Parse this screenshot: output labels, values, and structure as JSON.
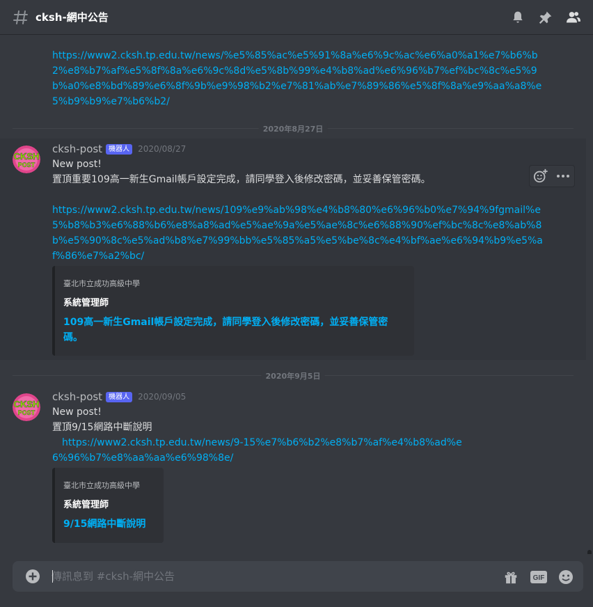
{
  "header": {
    "channel_name": "cksh-網中公告",
    "icons": [
      "hashtag-icon",
      "bell-icon",
      "pin-icon",
      "members-icon"
    ]
  },
  "top_link": "https://www2.cksh.tp.edu.tw/news/%e5%85%ac%e5%91%8a%e6%9c%ac%e6%a0%a1%e7%b6%b2%e8%b7%af%e5%8f%8a%e6%9c%8d%e5%8b%99%e4%b8%ad%e6%96%b7%ef%bc%8c%e5%9b%a0%e8%bd%89%e6%8f%9b%e9%98%b2%e7%81%ab%e7%89%86%e5%8f%8a%e9%aa%a8%e5%b9%b9%e7%b6%b2/",
  "dividers": [
    "2020年8月27日",
    "2020年9月5日"
  ],
  "messages": [
    {
      "author": "cksh-post",
      "badge": "機器人",
      "timestamp": "2020/08/27",
      "avatar_text": [
        "CKSH",
        "POST"
      ],
      "line1": "New post!",
      "line2": "置頂重要109高一新生Gmail帳戶設定完成，請同學登入後修改密碼，並妥善保管密碼。",
      "link": "https://www2.cksh.tp.edu.tw/news/109%e9%ab%98%e4%b8%80%e6%96%b0%e7%94%9fgmail%e5%b8%b3%e6%88%b6%e8%a8%ad%e5%ae%9a%e5%ae%8c%e6%88%90%ef%bc%8c%e8%ab%8b%e5%90%8c%e5%ad%b8%e7%99%bb%e5%85%a5%e5%be%8c%e4%bf%ae%e6%94%b9%e5%af%86%e7%a2%bc/",
      "embed": {
        "provider": "臺北市立成功高級中學",
        "author": "系統管理師",
        "title": "109高一新生Gmail帳戶設定完成，請同學登入後修改密碼，並妥善保管密碼。"
      }
    },
    {
      "author": "cksh-post",
      "badge": "機器人",
      "timestamp": "2020/09/05",
      "avatar_text": [
        "CKSH",
        "POST"
      ],
      "line1": "New post!",
      "line2": "置頂9/15網路中斷說明",
      "link": "https://www2.cksh.tp.edu.tw/news/9-15%e7%b6%b2%e8%b7%af%e4%b8%ad%e6%96%b7%e8%aa%aa%e6%98%8e/",
      "embed": {
        "provider": "臺北市立成功高級中學",
        "author": "系統管理師",
        "title": "9/15網路中斷說明"
      }
    }
  ],
  "hover_actions": [
    "add-reaction-icon",
    "more-icon"
  ],
  "composer": {
    "placeholder": "傳訊息到 #cksh-網中公告",
    "icons": [
      "add-attachment-icon",
      "gift-icon",
      "gif-icon",
      "emoji-icon"
    ],
    "gif_label": "GIF"
  },
  "colors": {
    "background": "#36393f",
    "link": "#00aff4",
    "badge": "#5865f2",
    "embed_bg": "#2f3136",
    "composer_bg": "#40444b"
  }
}
